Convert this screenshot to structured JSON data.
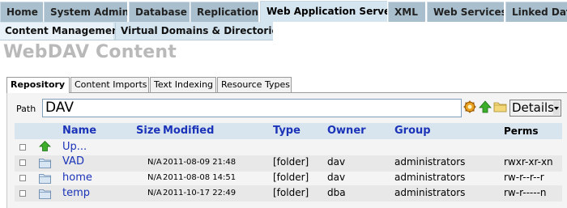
{
  "top_nav": {
    "tabs": [
      {
        "label": "Home",
        "active": false
      },
      {
        "label": "System Admin",
        "active": false
      },
      {
        "label": "Database",
        "active": false
      },
      {
        "label": "Replication",
        "active": false
      },
      {
        "label": "Web Application Server",
        "active": true
      },
      {
        "label": "XML",
        "active": false
      },
      {
        "label": "Web Services",
        "active": false
      },
      {
        "label": "Linked Data",
        "active": false
      }
    ]
  },
  "sub_nav": {
    "tabs": [
      {
        "label": "Content Management",
        "active": true
      },
      {
        "label": "Virtual Domains & Directories",
        "active": false
      }
    ]
  },
  "page_title": "WebDAV Content",
  "inner_tabs": [
    {
      "label": "Repository",
      "active": true
    },
    {
      "label": "Content Imports",
      "active": false
    },
    {
      "label": "Text Indexing",
      "active": false
    },
    {
      "label": "Resource Types",
      "active": false
    }
  ],
  "path_bar": {
    "label": "Path",
    "value": "DAV",
    "view_select": "Details",
    "icons": [
      "settings-icon",
      "up-arrow-icon",
      "folder-icon"
    ]
  },
  "table": {
    "columns": {
      "name": "Name",
      "size": "Size",
      "modified": "Modified",
      "type": "Type",
      "owner": "Owner",
      "group": "Group",
      "perms": "Perms"
    },
    "up_row": {
      "name": "Up..."
    },
    "rows": [
      {
        "name": "VAD",
        "size": "N/A",
        "modified": "2011-08-09 21:48",
        "type": "[folder]",
        "owner": "dav",
        "group": "administrators",
        "perms": "rwxr-xr-xn"
      },
      {
        "name": "home",
        "size": "N/A",
        "modified": "2011-08-08 14:51",
        "type": "[folder]",
        "owner": "dav",
        "group": "administrators",
        "perms": "rw-r--r--r"
      },
      {
        "name": "temp",
        "size": "N/A",
        "modified": "2011-10-17 22:49",
        "type": "[folder]",
        "owner": "dba",
        "group": "administrators",
        "perms": "rw-r-----n"
      }
    ]
  },
  "colors": {
    "tab_bg": "#a9bfcd",
    "tab_active_bg": "#d4e5f0",
    "link_blue": "#1a33b8",
    "title_gray": "#b9b9b9",
    "header_row_bg": "#d9e5ee"
  }
}
